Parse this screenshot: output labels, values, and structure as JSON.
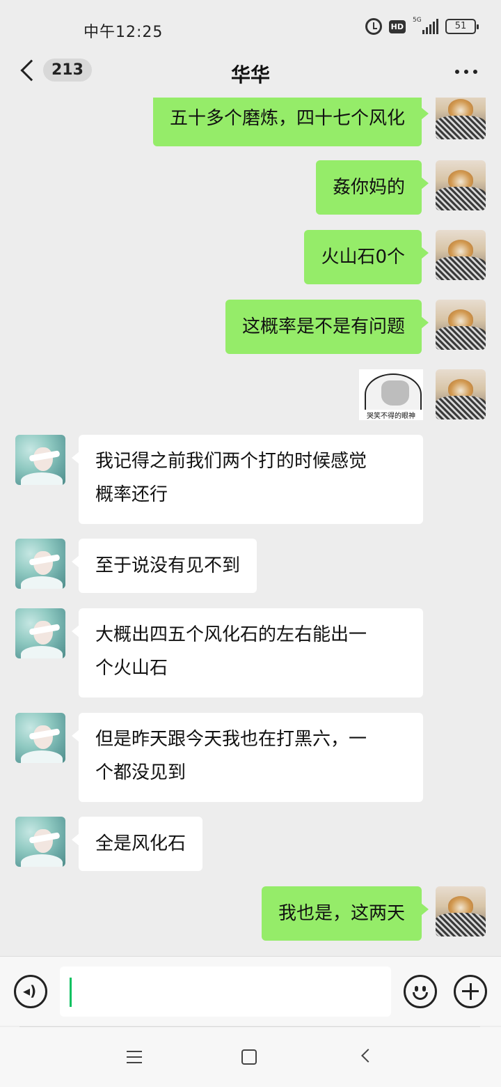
{
  "status_bar": {
    "time": "中午12:25",
    "network": "5G",
    "hd": "HD",
    "battery": "51"
  },
  "header": {
    "unread_count": "213",
    "title": "华华"
  },
  "messages": [
    {
      "side": "right",
      "text": "五十多个磨炼，四十七个风化"
    },
    {
      "side": "right",
      "text": "姦你妈的"
    },
    {
      "side": "right",
      "text": "火山石0个"
    },
    {
      "side": "right",
      "text": "这概率是不是有问题"
    },
    {
      "side": "right",
      "sticker_caption": "哭笑不得的眼神"
    },
    {
      "side": "left",
      "lines": [
        "我记得之前我们两个打的时候感觉",
        "概率还行"
      ]
    },
    {
      "side": "left",
      "text": "至于说没有见不到"
    },
    {
      "side": "left",
      "lines": [
        "大概出四五个风化石的左右能出一",
        "个火山石"
      ]
    },
    {
      "side": "left",
      "lines": [
        "但是昨天跟今天我也在打黑六，一",
        "个都没见到"
      ]
    },
    {
      "side": "left",
      "text": "全是风化石"
    },
    {
      "side": "right",
      "text": "我也是，这两天"
    }
  ],
  "input": {
    "value": ""
  },
  "colors": {
    "outgoing_bubble": "#95ec69",
    "incoming_bubble": "#ffffff",
    "background": "#ededed",
    "cursor": "#07c160"
  },
  "icons": {
    "back": "chevron-left-icon",
    "more": "more-dots-icon",
    "voice": "voice-icon",
    "emoji": "emoji-icon",
    "plus": "plus-icon",
    "nav_menu": "menu-icon",
    "nav_home": "home-icon",
    "nav_back": "back-icon"
  }
}
